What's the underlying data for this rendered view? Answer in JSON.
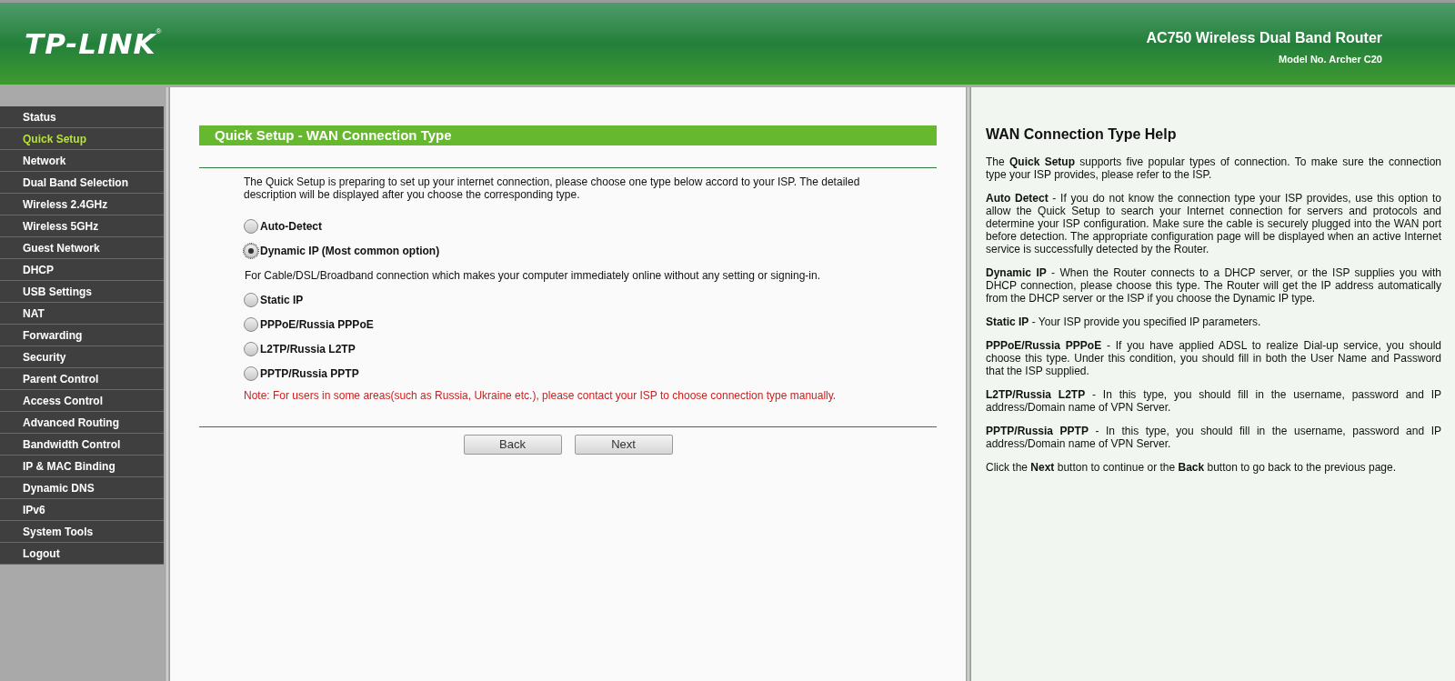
{
  "header": {
    "logo": "TP-LINK",
    "logo_mark": "®",
    "product": "AC750 Wireless Dual Band Router",
    "model": "Model No. Archer C20"
  },
  "sidebar": {
    "items": [
      {
        "label": "Status",
        "selected": false
      },
      {
        "label": "Quick Setup",
        "selected": true
      },
      {
        "label": "Network",
        "selected": false
      },
      {
        "label": "Dual Band Selection",
        "selected": false
      },
      {
        "label": "Wireless 2.4GHz",
        "selected": false
      },
      {
        "label": "Wireless 5GHz",
        "selected": false
      },
      {
        "label": "Guest Network",
        "selected": false
      },
      {
        "label": "DHCP",
        "selected": false
      },
      {
        "label": "USB Settings",
        "selected": false
      },
      {
        "label": "NAT",
        "selected": false
      },
      {
        "label": "Forwarding",
        "selected": false
      },
      {
        "label": "Security",
        "selected": false
      },
      {
        "label": "Parent Control",
        "selected": false
      },
      {
        "label": "Access Control",
        "selected": false
      },
      {
        "label": "Advanced Routing",
        "selected": false
      },
      {
        "label": "Bandwidth Control",
        "selected": false
      },
      {
        "label": "IP & MAC Binding",
        "selected": false
      },
      {
        "label": "Dynamic DNS",
        "selected": false
      },
      {
        "label": "IPv6",
        "selected": false
      },
      {
        "label": "System Tools",
        "selected": false
      },
      {
        "label": "Logout",
        "selected": false
      }
    ]
  },
  "main": {
    "title": "Quick Setup - WAN Connection Type",
    "intro": "The Quick Setup is preparing to set up your internet connection, please choose one type below accord to your ISP. The detailed description will be displayed after you choose the corresponding type.",
    "options": [
      {
        "label": "Auto-Detect",
        "selected": false
      },
      {
        "label": "Dynamic IP (Most common option)",
        "selected": true,
        "description": "For Cable/DSL/Broadband connection which makes your computer immediately online without any setting or signing-in."
      },
      {
        "label": "Static IP",
        "selected": false
      },
      {
        "label": "PPPoE/Russia PPPoE",
        "selected": false
      },
      {
        "label": "L2TP/Russia L2TP",
        "selected": false
      },
      {
        "label": "PPTP/Russia PPTP",
        "selected": false
      }
    ],
    "note": "Note: For users in some areas(such as Russia, Ukraine etc.), please contact your ISP to choose connection type manually.",
    "buttons": [
      "Back",
      "Next"
    ]
  },
  "help": {
    "title": "WAN Connection Type Help",
    "paragraphs": [
      "The **Quick Setup** supports five popular types of connection. To make sure the connection type your ISP provides, please refer to the ISP.",
      "**Auto Detect** - If you do not know the connection type your ISP provides, use this option to allow the Quick Setup to search your Internet connection for servers and protocols and determine your ISP configuration. Make sure the cable is securely plugged into the WAN port before detection. The appropriate configuration page will be displayed when an active Internet service is successfully detected by the Router.",
      "**Dynamic IP** - When the Router connects to a DHCP server, or the ISP supplies you with DHCP connection, please choose this type. The Router will get the IP address automatically from the DHCP server or the ISP if you choose the Dynamic IP type.",
      "**Static IP** - Your ISP provide you specified IP parameters.",
      "**PPPoE/Russia PPPoE** - If you have applied ADSL to realize Dial-up service, you should choose this type. Under this condition, you should fill in both the User Name and Password that the ISP supplied.",
      "**L2TP/Russia L2TP** - In this type, you should fill in the username, password and IP address/Domain name of VPN Server.",
      "**PPTP/Russia PPTP** - In this type, you should fill in the username, password and IP address/Domain name of VPN Server.",
      "Click the **Next** button to continue or the **Back** button to go back to the previous page."
    ]
  }
}
